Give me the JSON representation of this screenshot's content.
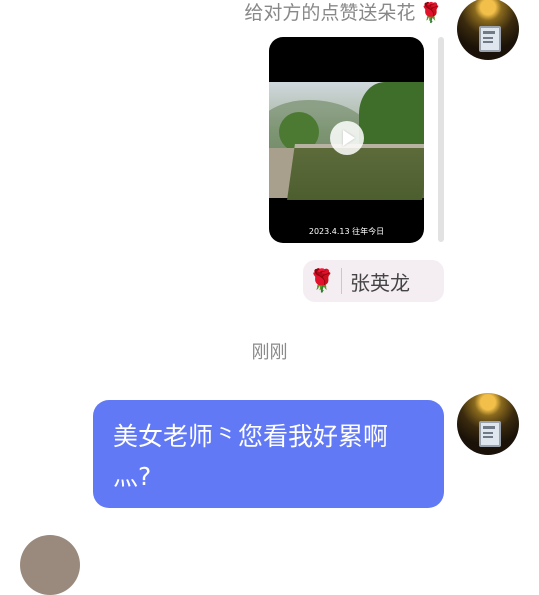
{
  "header": {
    "caption": "给对方的点赞送朵花",
    "caption_icon": "rose-icon"
  },
  "video_card": {
    "timestamp": "2023.4.13 往年今日",
    "play_icon": "play-icon"
  },
  "name_tag": {
    "icon": "rose-icon",
    "name": "张英龙"
  },
  "time_divider": "刚刚",
  "message": {
    "text": "美女老师⺀您看我好累啊灬?"
  },
  "colors": {
    "bubble": "#6279f5",
    "tag_bg": "#f4eef2",
    "rose": "#e0425a"
  }
}
